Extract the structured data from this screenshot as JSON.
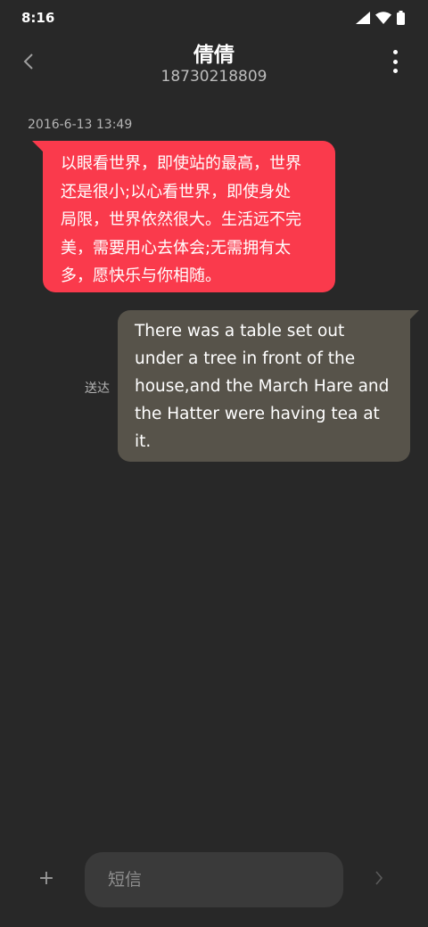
{
  "status_bar": {
    "time": "8:16",
    "icons": [
      "signal-icon",
      "wifi-icon",
      "battery-icon"
    ]
  },
  "header": {
    "contact_name": "倩倩",
    "contact_number": "18730218809",
    "back_icon": "chevron-left-icon",
    "more_icon": "more-vertical-icon"
  },
  "conversation": {
    "timestamp": "2016-6-13 13:49",
    "messages": [
      {
        "direction": "incoming",
        "lines": [
          "以眼看世界，即使站的最高，世界",
          "还是很小;以心看世界，即使身处",
          "局限，世界依然很大。生活远不完",
          "美，需要用心去体会;无需拥有太",
          "多，愿快乐与你相随。"
        ]
      },
      {
        "direction": "outgoing",
        "status": "送达",
        "lines": [
          "There was a table set out",
          "under a tree in front of the",
          "house,and the March Hare and",
          "the Hatter were having tea at",
          "it."
        ]
      }
    ]
  },
  "composer": {
    "add_label": "+",
    "placeholder": "短信",
    "value": "",
    "send_icon": "chevron-right-icon"
  },
  "colors": {
    "background": "#282828",
    "incoming_bubble": "#fa3a4c",
    "outgoing_bubble": "#57534a",
    "input_background": "#3a3a3a",
    "muted_text": "#b5b5b5"
  }
}
